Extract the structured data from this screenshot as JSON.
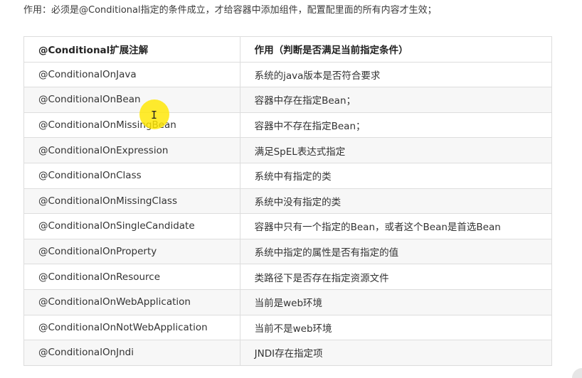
{
  "intro_text": "作用：必须是@Conditional指定的条件成立，才给容器中添加组件，配置配里面的所有内容才生效；",
  "table": {
    "headers": [
      "@Conditional扩展注解",
      "作用（判断是否满足当前指定条件）"
    ],
    "rows": [
      [
        "@ConditionalOnJava",
        "系统的java版本是否符合要求"
      ],
      [
        "@ConditionalOnBean",
        "容器中存在指定Bean；"
      ],
      [
        "@ConditionalOnMissingBean",
        "容器中不存在指定Bean；"
      ],
      [
        "@ConditionalOnExpression",
        "满足SpEL表达式指定"
      ],
      [
        "@ConditionalOnClass",
        "系统中有指定的类"
      ],
      [
        "@ConditionalOnMissingClass",
        "系统中没有指定的类"
      ],
      [
        "@ConditionalOnSingleCandidate",
        "容器中只有一个指定的Bean，或者这个Bean是首选Bean"
      ],
      [
        "@ConditionalOnProperty",
        "系统中指定的属性是否有指定的值"
      ],
      [
        "@ConditionalOnResource",
        "类路径下是否存在指定资源文件"
      ],
      [
        "@ConditionalOnWebApplication",
        "当前是web环境"
      ],
      [
        "@ConditionalOnNotWebApplication",
        "当前不是web环境"
      ],
      [
        "@ConditionalOnJndi",
        "JNDI存在指定项"
      ]
    ]
  },
  "cursor": {
    "icon": "text-cursor-icon",
    "highlight_color": "#ffe600",
    "glyph": "I"
  }
}
